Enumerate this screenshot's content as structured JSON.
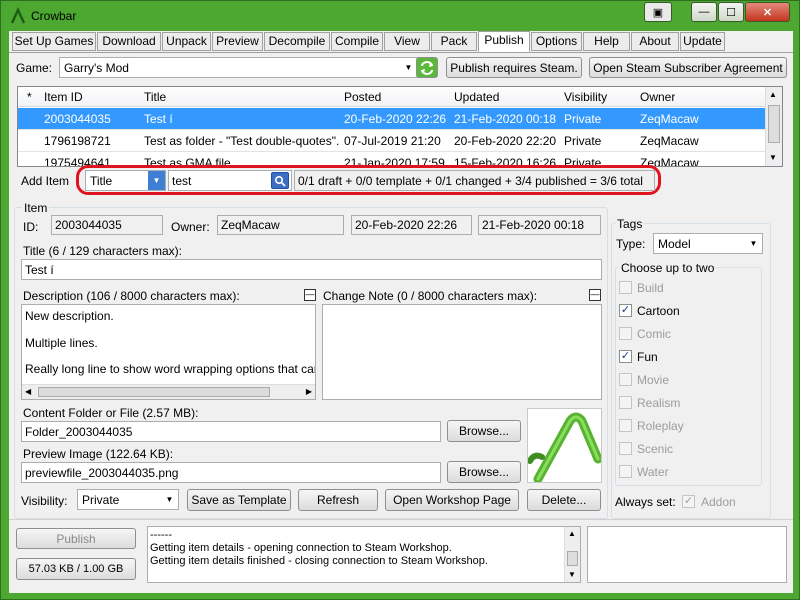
{
  "window": {
    "title": "Crowbar"
  },
  "tabs": [
    {
      "label": "Set Up Games"
    },
    {
      "label": "Download"
    },
    {
      "label": "Unpack"
    },
    {
      "label": "Preview"
    },
    {
      "label": "Decompile"
    },
    {
      "label": "Compile"
    },
    {
      "label": "View"
    },
    {
      "label": "Pack"
    },
    {
      "label": "Publish"
    },
    {
      "label": "Options"
    },
    {
      "label": "Help"
    },
    {
      "label": "About"
    },
    {
      "label": "Update"
    }
  ],
  "game": {
    "label": "Game:",
    "value": "Garry's Mod",
    "publish_btn": "Publish requires Steam.",
    "agreement_btn": "Open Steam Subscriber Agreement"
  },
  "grid": {
    "headers": [
      "*",
      "Item ID",
      "Title",
      "Posted",
      "Updated",
      "Visibility",
      "Owner"
    ],
    "rows": [
      {
        "star": "",
        "id": "2003044035",
        "title": "Test í",
        "posted": "20-Feb-2020 22:26",
        "updated": "21-Feb-2020 00:18",
        "visibility": "Private",
        "owner": "ZeqMacaw",
        "selected": true
      },
      {
        "star": "",
        "id": "1796198721",
        "title": "Test as folder - \"Test double-quotes\"...",
        "posted": "07-Jul-2019 21:20",
        "updated": "20-Feb-2020 22:20",
        "visibility": "Private",
        "owner": "ZeqMacaw",
        "selected": false
      },
      {
        "star": "",
        "id": "1975494641",
        "title": "Test as GMA file",
        "posted": "21-Jan-2020 17:59",
        "updated": "15-Feb-2020 16:26",
        "visibility": "Private",
        "owner": "ZeqMacaw",
        "selected": false
      }
    ]
  },
  "search": {
    "add_item": "Add Item",
    "field": "Title",
    "query": "test",
    "summary": "0/1 draft + 0/0 template + 0/1 changed + 3/4 published = 3/6 total",
    "highlight_color": "#e0141e"
  },
  "item": {
    "group_label": "Item",
    "id_label": "ID:",
    "id": "2003044035",
    "owner_label": "Owner:",
    "owner": "ZeqMacaw",
    "posted": "20-Feb-2020 22:26",
    "updated": "21-Feb-2020 00:18",
    "title_label": "Title (6 / 129 characters max):",
    "title": "Test í",
    "desc_label": "Description (106 / 8000 characters max):",
    "desc_lines": [
      "New description.",
      "Multiple lines.",
      "Really long line to show word wrapping options that can be c"
    ],
    "change_label": "Change Note (0 / 8000 characters max):",
    "content_label": "Content Folder or File (2.57 MB):",
    "content": "Folder_2003044035",
    "preview_label": "Preview Image (122.64 KB):",
    "preview": "previewfile_2003044035.png",
    "browse": "Browse...",
    "visibility_label": "Visibility:",
    "visibility": "Private",
    "save_template": "Save as Template",
    "refresh": "Refresh",
    "open_workshop": "Open Workshop Page",
    "delete": "Delete..."
  },
  "tags": {
    "group_label": "Tags",
    "type_label": "Type:",
    "type": "Model",
    "choose_label": "Choose up to two",
    "items": [
      {
        "label": "Build",
        "checked": false,
        "enabled": false
      },
      {
        "label": "Cartoon",
        "checked": true,
        "enabled": true
      },
      {
        "label": "Comic",
        "checked": false,
        "enabled": false
      },
      {
        "label": "Fun",
        "checked": true,
        "enabled": true
      },
      {
        "label": "Movie",
        "checked": false,
        "enabled": false
      },
      {
        "label": "Realism",
        "checked": false,
        "enabled": false
      },
      {
        "label": "Roleplay",
        "checked": false,
        "enabled": false
      },
      {
        "label": "Scenic",
        "checked": false,
        "enabled": false
      },
      {
        "label": "Water",
        "checked": false,
        "enabled": false
      }
    ],
    "always_label": "Always set:",
    "addon": "Addon"
  },
  "bottom": {
    "publish": "Publish",
    "size": "57.03 KB / 1.00 GB",
    "log": [
      "------",
      "Getting item details - opening connection to Steam Workshop.",
      "Getting item details finished - closing connection to Steam Workshop."
    ]
  }
}
